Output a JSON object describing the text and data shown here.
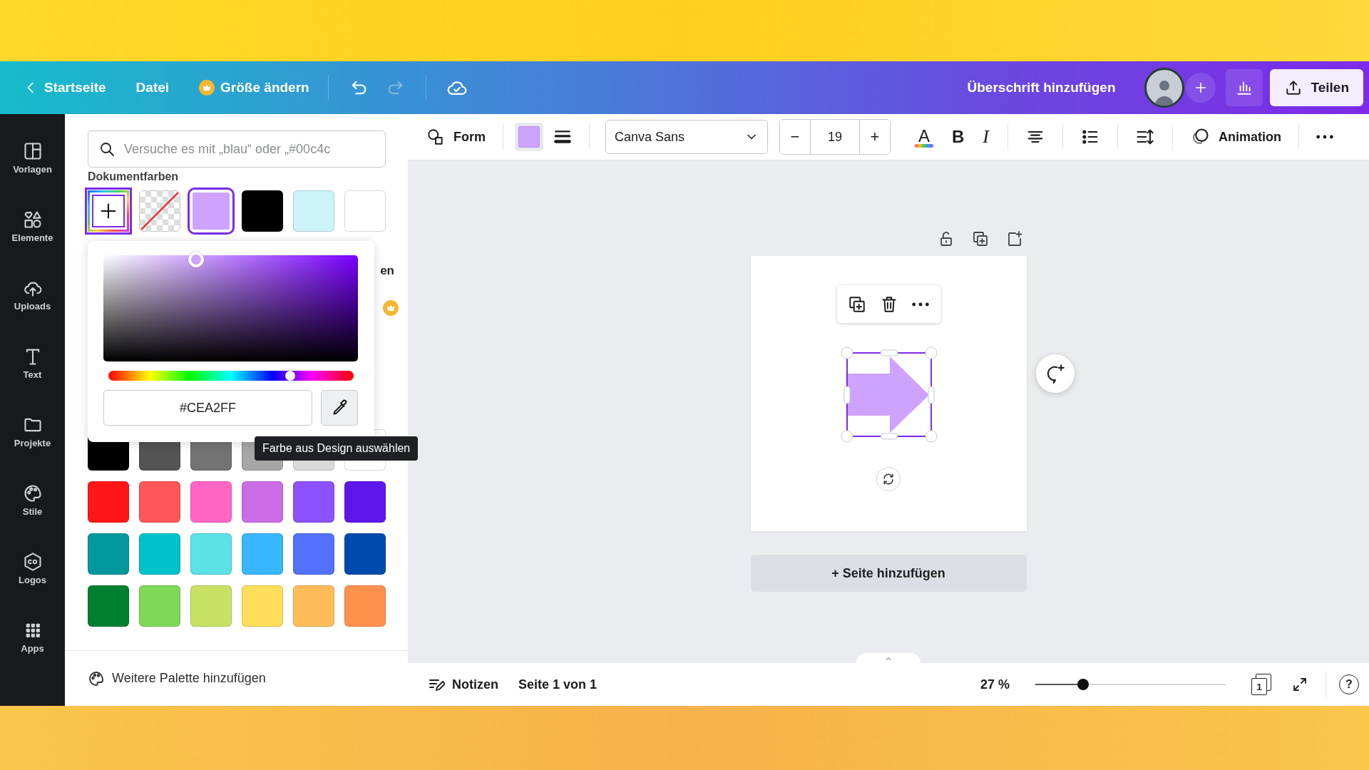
{
  "top_bar": {
    "back_label": "Startseite",
    "items": [
      {
        "kind": "menu",
        "label": "Datei"
      },
      {
        "kind": "premium",
        "label": "Größe ändern"
      }
    ],
    "undo": {
      "disabled": false
    },
    "redo": {
      "disabled": true
    },
    "title": "Überschrift hinzufügen",
    "share_label": "Teilen"
  },
  "sidebar": {
    "items": [
      {
        "kind": "templates",
        "label": "Vorlagen"
      },
      {
        "kind": "elements",
        "label": "Elemente"
      },
      {
        "kind": "uploads",
        "label": "Uploads"
      },
      {
        "kind": "text",
        "label": "Text"
      },
      {
        "kind": "projects",
        "label": "Projekte"
      },
      {
        "kind": "styles",
        "label": "Stile"
      },
      {
        "kind": "logos",
        "label": "Logos"
      },
      {
        "kind": "apps",
        "label": "Apps"
      }
    ]
  },
  "color_panel": {
    "search": {
      "placeholder": "Versuche es mit „blau“ oder „#00c4c"
    },
    "doc_heading": "Dokumentfarben",
    "doc_swatches": [
      {
        "kind": "add",
        "selected": true
      },
      {
        "kind": "transparent",
        "selected": false
      },
      {
        "kind": "color",
        "color": "#cea2ff",
        "selected": true
      },
      {
        "kind": "color",
        "color": "#000000",
        "selected": false
      },
      {
        "kind": "color",
        "color": "#ccf3f8",
        "selected": false
      },
      {
        "kind": "color",
        "color": "#ffffff",
        "selected": false
      }
    ],
    "covered_heading": "en",
    "palette": [
      {
        "color": "#000000"
      },
      {
        "color": "#545454"
      },
      {
        "color": "#737373"
      },
      {
        "color": "#a6a6a6"
      },
      {
        "color": "#d9d9d9"
      },
      {
        "color": "#ffffff"
      },
      {
        "color": "#ff1616"
      },
      {
        "color": "#ff5757"
      },
      {
        "color": "#ff66c4"
      },
      {
        "color": "#cb6ce6"
      },
      {
        "color": "#8c52ff"
      },
      {
        "color": "#5e17eb"
      },
      {
        "color": "#03989e"
      },
      {
        "color": "#00c2cb"
      },
      {
        "color": "#5ce1e6"
      },
      {
        "color": "#38b6ff"
      },
      {
        "color": "#5271ff"
      },
      {
        "color": "#004aad"
      },
      {
        "color": "#00802f"
      },
      {
        "color": "#7ed957"
      },
      {
        "color": "#c9e265"
      },
      {
        "color": "#ffde59"
      },
      {
        "color": "#ffbd59"
      },
      {
        "color": "#ff914d"
      }
    ],
    "footer": "Weitere Palette hinzufügen"
  },
  "color_picker": {
    "hex": "#CEA2FF",
    "hue_slider": {
      "level": 0.74
    },
    "tooltip": "Farbe aus Design auswählen"
  },
  "toolbar": {
    "shape_label": "Form",
    "font": "Canva Sans",
    "font_size": "19",
    "minus": "−",
    "plus": "+",
    "color_glyph": "A",
    "bold_glyph": "B",
    "italic_glyph": "I",
    "animation_label": "Animation"
  },
  "canvas": {
    "add_page_label": "+ Seite hinzufügen"
  },
  "bottom_bar": {
    "notes_label": "Notizen",
    "page_info": "Seite 1 von 1",
    "zoom_reading": "27 %",
    "zoom_slider": {
      "level": 0.25
    },
    "page_count": "1",
    "help": "?"
  }
}
